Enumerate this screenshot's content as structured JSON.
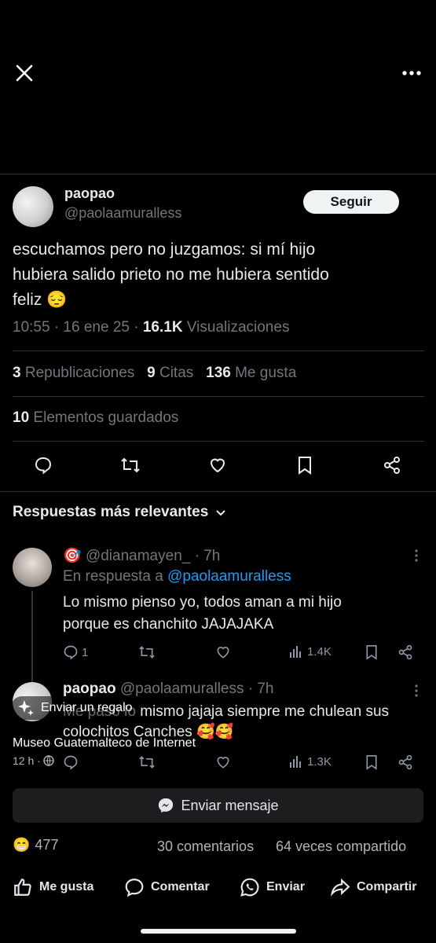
{
  "post": {
    "display_name": "paopao",
    "handle": "@paolaamuralless",
    "follow_label": "Seguir",
    "text_line1": "escuchamos pero no juzgamos: si mí hijo",
    "text_line2": "hubiera salido prieto no me hubiera sentido",
    "text_line3": "feliz 😔",
    "time": "10:55 · 16 ene 25 · ",
    "views_count": "16.1K",
    "views_label": " Visualizaciones",
    "reposts_count": "3",
    "reposts_label": "Republicaciones",
    "quotes_count": "9",
    "quotes_label": "Citas",
    "likes_count": "136",
    "likes_label": "Me gusta",
    "bookmarks_count": "10",
    "bookmarks_label": "Elementos guardados"
  },
  "replies_header": "Respuestas más relevantes",
  "replies": [
    {
      "badge": "🎯",
      "handle": "@dianamayen_",
      "time": " · 7h",
      "reply_to_label": "En respuesta a ",
      "reply_to_handle": "@paolaamuralless",
      "text_line1": "Lo mismo pienso yo, todos aman a mi hijo",
      "text_line2": "porque es chanchito JAJAJAKA",
      "reply_count": "1",
      "views": "1.4K"
    },
    {
      "display_name": "paopao",
      "handle": "@paolaamuralless",
      "time": " · 7h",
      "text_line1": "Me pasó lo mismo jajaja siempre me chulean sus",
      "text_line2": "colochitos Canches 🥰🥰",
      "views": "1.3K"
    }
  ],
  "overlay": {
    "gift_label": "Enviar un regalo",
    "page_name": "Museo Guatemalteco de Internet",
    "post_time": "12 h ·"
  },
  "facebook": {
    "send_message_label": "Enviar mensaje",
    "reaction_emoji": "😁",
    "reaction_count": "477",
    "comments": "30 comentarios",
    "shares": "64 veces compartido",
    "like_label": "Me gusta",
    "comment_label": "Comentar",
    "send_label": "Enviar",
    "share_label": "Compartir"
  },
  "colors": {
    "background": "#000000",
    "link_blue": "#1d9bf0",
    "muted_gray": "#71767b"
  }
}
